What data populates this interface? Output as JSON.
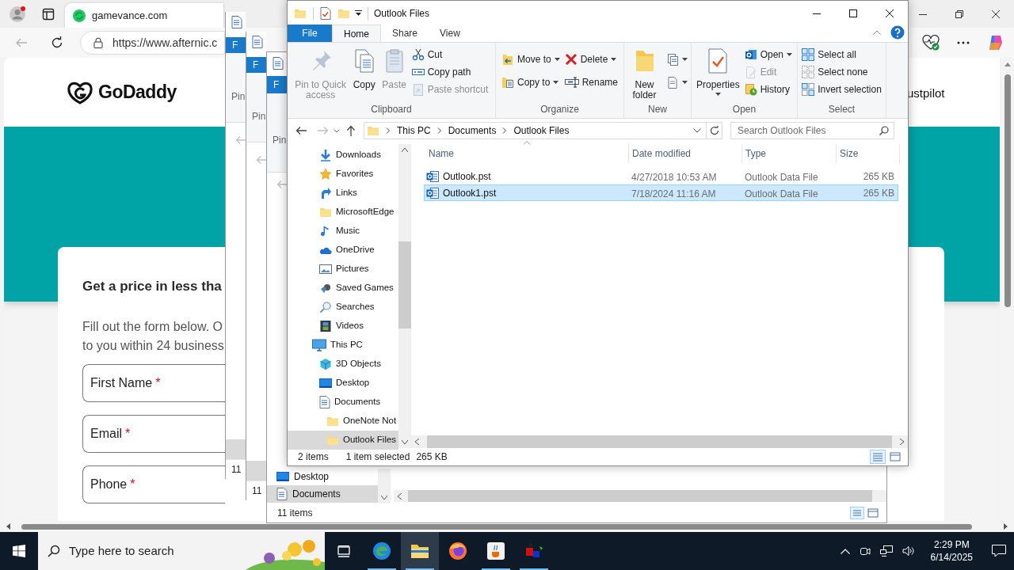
{
  "browser": {
    "tab": {
      "title": "gamevance.com",
      "selected": true
    },
    "address": "https://www.afternic.c",
    "page": {
      "logo": "GoDaddy",
      "header_right": "ustpilot",
      "form": {
        "heading": "Get a price in less tha",
        "intro_lines": [
          "Fill out the form below. O",
          "to you within 24 business"
        ],
        "fields": [
          {
            "label": "First Name",
            "required_mark": "*"
          },
          {
            "label": "Email",
            "required_mark": "*"
          },
          {
            "label": "Phone",
            "required_mark": "*"
          }
        ]
      }
    }
  },
  "background_windows": [
    {
      "file_tab": "F",
      "pin_label": "Pin",
      "status": "11"
    },
    {
      "file_tab": "F",
      "pin_label": "Pin",
      "status": "11"
    },
    {
      "file_tab": "F",
      "pin_label": "Pin",
      "status": "11 items",
      "nav_items": [
        {
          "label": "Desktop",
          "kind": "desktop",
          "selected": false
        },
        {
          "label": "Documents",
          "kind": "documents",
          "selected": true
        }
      ]
    }
  ],
  "explorer": {
    "title": "Outlook Files",
    "tabs": [
      {
        "label": "File",
        "kind": "file",
        "selected": false
      },
      {
        "label": "Home",
        "kind": "tab",
        "selected": true
      },
      {
        "label": "Share",
        "kind": "tab",
        "selected": false
      },
      {
        "label": "View",
        "kind": "tab",
        "selected": false
      }
    ],
    "ribbon": [
      {
        "label": "Clipboard",
        "columns": [
          [
            {
              "kind": "pin",
              "label": "Pin to Quick access",
              "disabled": true
            }
          ],
          [
            {
              "kind": "copy",
              "label": "Copy",
              "disabled": false
            }
          ],
          [
            {
              "kind": "paste",
              "label": "Paste",
              "disabled": true
            }
          ],
          [
            {
              "kind": "cut",
              "label": "Cut",
              "disabled": false
            },
            {
              "kind": "copy_path",
              "label": "Copy path",
              "disabled": false
            },
            {
              "kind": "paste_shortcut",
              "label": "Paste shortcut",
              "disabled": true
            }
          ]
        ]
      },
      {
        "label": "Organize",
        "columns": [
          [
            {
              "kind": "move_to",
              "label": "Move to",
              "disabled": false,
              "dropdown": true
            },
            {
              "kind": "copy_to",
              "label": "Copy to",
              "disabled": false,
              "dropdown": true
            }
          ],
          [
            {
              "kind": "delete",
              "label": "Delete",
              "disabled": false,
              "dropdown": true
            },
            {
              "kind": "rename",
              "label": "Rename",
              "disabled": false
            }
          ]
        ]
      },
      {
        "label": "New",
        "columns": [
          [
            {
              "kind": "new_folder",
              "label": "New folder",
              "disabled": false
            }
          ],
          [
            {
              "kind": "new_item",
              "disabled": false,
              "dropdown": true
            },
            {
              "kind": "easy_access",
              "disabled": false,
              "dropdown": true
            }
          ]
        ]
      },
      {
        "label": "Open",
        "columns": [
          [
            {
              "kind": "properties",
              "label": "Properties",
              "disabled": false,
              "dropdown": true
            }
          ],
          [
            {
              "kind": "open",
              "label": "Open",
              "disabled": false,
              "dropdown": true
            },
            {
              "kind": "edit",
              "label": "Edit",
              "disabled": true
            },
            {
              "kind": "history",
              "label": "History",
              "disabled": false
            }
          ]
        ]
      },
      {
        "label": "Select",
        "columns": [
          [
            {
              "kind": "select_all",
              "label": "Select all",
              "disabled": false
            },
            {
              "kind": "select_none",
              "label": "Select none",
              "disabled": false
            },
            {
              "kind": "invert_selection",
              "label": "Invert selection",
              "disabled": false
            }
          ]
        ]
      }
    ],
    "breadcrumb": [
      "This PC",
      "Documents",
      "Outlook Files"
    ],
    "search_placeholder": "Search Outlook Files",
    "nav_tree": [
      {
        "children": [
          {
            "label": "Downloads",
            "kind": "downloads",
            "selected": false
          },
          {
            "label": "Favorites",
            "kind": "favorites",
            "selected": false
          },
          {
            "label": "Links",
            "kind": "links",
            "selected": false
          },
          {
            "label": "MicrosoftEdge",
            "kind": "folder",
            "selected": false
          },
          {
            "label": "Music",
            "kind": "music",
            "selected": false
          },
          {
            "label": "OneDrive",
            "kind": "onedrive",
            "selected": false
          },
          {
            "label": "Pictures",
            "kind": "pictures",
            "selected": false
          },
          {
            "label": "Saved Games",
            "kind": "games",
            "selected": false
          },
          {
            "label": "Searches",
            "kind": "searches",
            "selected": false
          },
          {
            "label": "Videos",
            "kind": "videos",
            "selected": false
          }
        ]
      },
      {
        "label": "This PC",
        "kind": "pc",
        "selected": false,
        "children": [
          {
            "label": "3D Objects",
            "kind": "objects3d",
            "selected": false
          },
          {
            "label": "Desktop",
            "kind": "desktop",
            "selected": false
          },
          {
            "label": "Documents",
            "kind": "documents",
            "selected": false,
            "children": [
              {
                "label": "OneNote Not",
                "kind": "folder",
                "selected": false
              },
              {
                "label": "Outlook Files",
                "kind": "folder",
                "selected": true
              }
            ]
          }
        ]
      }
    ],
    "columns": [
      {
        "label": "Name",
        "sorted": true
      },
      {
        "label": "Date modified",
        "sorted": false
      },
      {
        "label": "Type",
        "sorted": false
      },
      {
        "label": "Size",
        "sorted": false
      }
    ],
    "files": [
      {
        "name": "Outlook.pst",
        "date": "4/27/2018 10:53 AM",
        "type": "Outlook Data File",
        "size": "265 KB",
        "selected": false
      },
      {
        "name": "Outlook1.pst",
        "date": "7/18/2024 11:16 AM",
        "type": "Outlook Data File",
        "size": "265 KB",
        "selected": true
      }
    ],
    "status": [
      "2 items",
      "1 item selected",
      "265 KB"
    ],
    "views": [
      {
        "kind": "details",
        "selected": true
      },
      {
        "kind": "large_icons",
        "selected": false
      }
    ]
  },
  "taskbar": {
    "search_placeholder": "Type here to search",
    "apps": [
      {
        "kind": "task_view",
        "running": false,
        "selected": false
      },
      {
        "kind": "edge",
        "running": true,
        "selected": false
      },
      {
        "kind": "explorer",
        "running": true,
        "selected": true
      },
      {
        "kind": "firefox",
        "running": false,
        "selected": false
      },
      {
        "kind": "java",
        "running": true,
        "selected": false
      },
      {
        "kind": "app",
        "running": true,
        "selected": false
      }
    ],
    "time": "2:29 PM",
    "date": "6/14/2025"
  }
}
